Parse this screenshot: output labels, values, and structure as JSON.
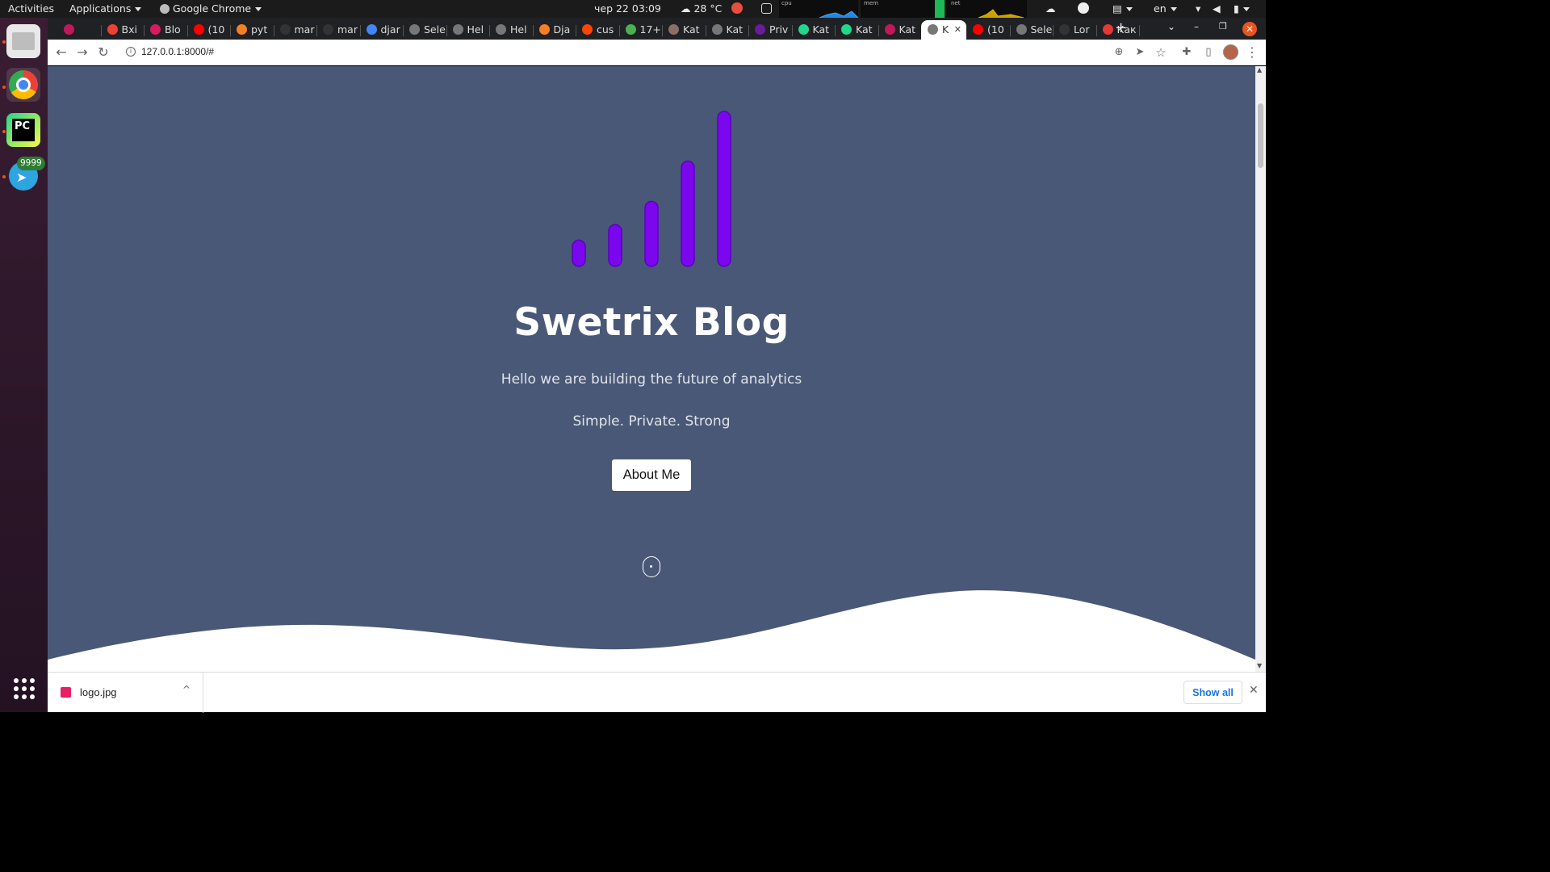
{
  "system_bar": {
    "activities": "Activities",
    "applications": "Applications",
    "active_app": "Google Chrome",
    "datetime": "чер 22  03:09",
    "weather": "28 °C",
    "graph_labels": [
      "cpu",
      "mem",
      "net"
    ],
    "language": "en"
  },
  "dock": {
    "apps": [
      {
        "name": "files-icon",
        "badge": ""
      },
      {
        "name": "chrome-icon",
        "badge": ""
      },
      {
        "name": "pycharm-icon",
        "badge": ""
      },
      {
        "name": "telegram-icon",
        "badge": "9999"
      }
    ]
  },
  "tabs": [
    {
      "label": "",
      "color": "#c2185b"
    },
    {
      "label": "Bxi",
      "color": "#ea4335"
    },
    {
      "label": "Blo",
      "color": "#d81b60"
    },
    {
      "label": "(10",
      "color": "#ff0000"
    },
    {
      "label": "pyt",
      "color": "#f48024"
    },
    {
      "label": "mar",
      "color": "#333333"
    },
    {
      "label": "mar",
      "color": "#333333"
    },
    {
      "label": "djar",
      "color": "#4285f4"
    },
    {
      "label": "Sele",
      "color": "#777777"
    },
    {
      "label": "Hel",
      "color": "#777777"
    },
    {
      "label": "Hel",
      "color": "#777777"
    },
    {
      "label": "Dja",
      "color": "#f48024"
    },
    {
      "label": "cus",
      "color": "#ff4500"
    },
    {
      "label": "17+",
      "color": "#4caf50"
    },
    {
      "label": "Kat",
      "color": "#8d6e63"
    },
    {
      "label": "Kat",
      "color": "#777777"
    },
    {
      "label": "Priv",
      "color": "#6a1b9a"
    },
    {
      "label": "Kat",
      "color": "#21d789"
    },
    {
      "label": "Kat",
      "color": "#21d789"
    },
    {
      "label": "Kat",
      "color": "#c2185b"
    },
    {
      "label": "K",
      "color": "#777777",
      "active": true
    },
    {
      "label": "(10",
      "color": "#ff0000"
    },
    {
      "label": "Sele",
      "color": "#777777"
    },
    {
      "label": "Lor",
      "color": "#333333"
    },
    {
      "label": "Как",
      "color": "#e53935"
    }
  ],
  "address_bar": {
    "url": "127.0.0.1:8000/#"
  },
  "page": {
    "title": "Swetrix Blog",
    "subtitle": "Hello we are building the future of analytics",
    "tagline": "Simple. Private. Strong",
    "about_button": "About Me",
    "logo_bar_levels": [
      0.17,
      0.27,
      0.42,
      0.68,
      1.0
    ],
    "colors": {
      "background": "#4a5877",
      "logo": "#7b07ee",
      "wave": "#ffffff"
    }
  },
  "download_bar": {
    "file_name": "logo.jpg",
    "show_all": "Show all"
  }
}
